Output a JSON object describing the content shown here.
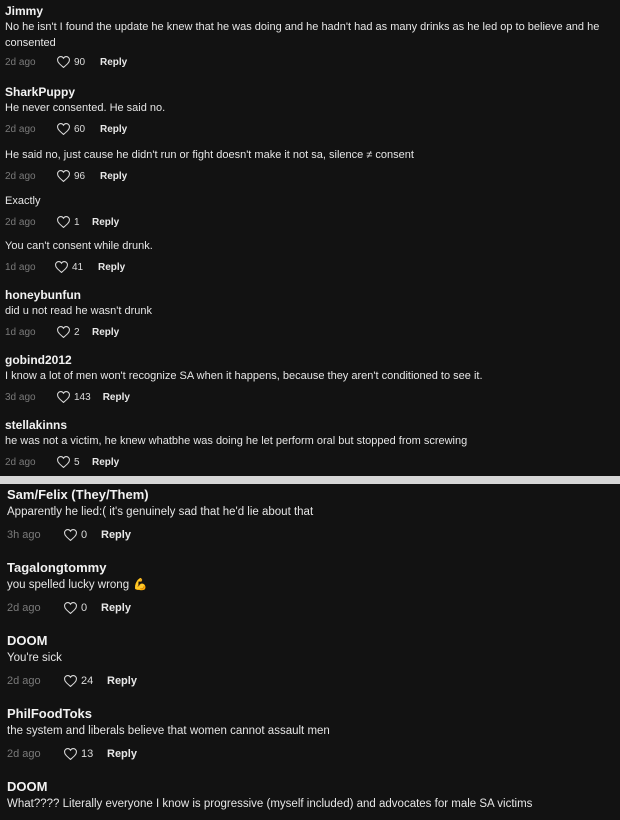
{
  "colors": {
    "background": "#121212",
    "divider": "#d6d6d6",
    "username": "#f2f2f2",
    "timestamp": "#7a7a7a"
  },
  "reply_label": "Reply",
  "top_comments": [
    {
      "username": "Jimmy",
      "text": "No he isn't I found the update he knew that he was doing and he hadn't had as many drinks as he led op to believe and he consented",
      "time": "2d ago",
      "likes": "90"
    },
    {
      "username": "SharkPuppy",
      "text": "He never consented. He said no.",
      "time": "2d ago",
      "likes": "60"
    },
    {
      "username": "",
      "text": "He said no, just cause he didn't run or fight doesn't make it not sa, silence ≠ consent",
      "time": "2d ago",
      "likes": "96"
    },
    {
      "username": "",
      "text": "Exactly",
      "time": "2d ago",
      "likes": "1"
    },
    {
      "username": "",
      "text": "You can't consent while drunk.",
      "time": "1d ago",
      "likes": "41"
    },
    {
      "username": "honeybunfun",
      "text": "did u not read he wasn't drunk",
      "time": "1d ago",
      "likes": "2"
    },
    {
      "username": "gobind2012",
      "text": "I know a lot of men won't recognize SA when it happens, because they aren't conditioned to see it.",
      "time": "3d ago",
      "likes": "143"
    },
    {
      "username": "stellakinns",
      "text": "he was not a victim, he knew whatbhe was doing he let perform oral but stopped from screwing",
      "time": "2d ago",
      "likes": "5"
    }
  ],
  "bottom_comments": [
    {
      "username": "Sam/Felix (They/Them)",
      "text": "Apparently he lied:( it's genuinely sad that he'd lie about that",
      "time": "3h ago",
      "likes": "0"
    },
    {
      "username": "Tagalongtommy",
      "text": "you spelled lucky wrong",
      "emoji": "💪",
      "time": "2d ago",
      "likes": "0"
    },
    {
      "username": "DOOM",
      "text": "You're sick",
      "time": "2d ago",
      "likes": "24"
    },
    {
      "username": "PhilFoodToks",
      "text": "the system and liberals believe that women cannot assault men",
      "time": "2d ago",
      "likes": "13"
    },
    {
      "username": "DOOM",
      "text": "What???? Literally everyone I know is progressive (myself included) and advocates for male SA victims"
    }
  ]
}
